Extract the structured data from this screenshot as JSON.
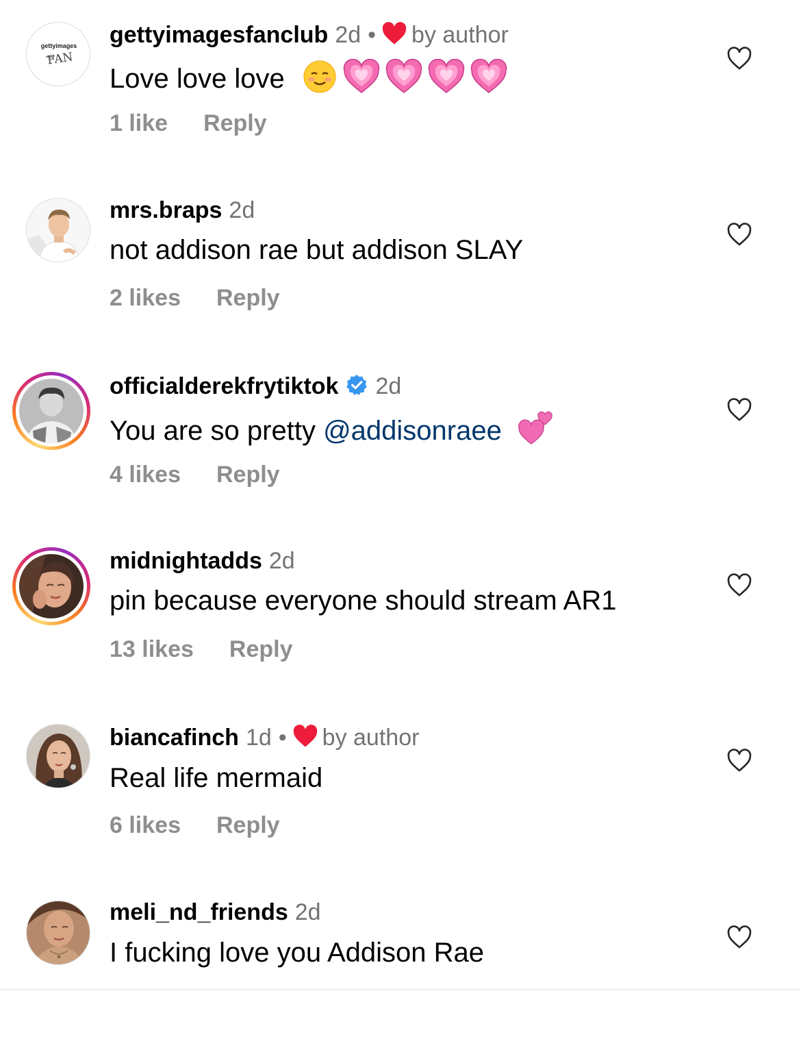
{
  "comments": [
    {
      "username": "gettyimagesfanclub",
      "time": "2d",
      "liked_by_author": true,
      "author_label": "by author",
      "text": "Love love love",
      "emojis": [
        "smiling-face-icon",
        "growing-heart-icon",
        "growing-heart-icon",
        "growing-heart-icon",
        "growing-heart-icon"
      ],
      "avatar_logo": "gettyimages FAN",
      "likes": "1 like",
      "reply": "Reply"
    },
    {
      "username": "mrs.braps",
      "time": "2d",
      "text": "not addison rae but addison SLAY",
      "likes": "2 likes",
      "reply": "Reply"
    },
    {
      "username": "officialderekfrytiktok",
      "verified": true,
      "time": "2d",
      "text": "You are so pretty ",
      "mention": "@addisonraee",
      "emojis": [
        "two-hearts-icon"
      ],
      "likes": "4 likes",
      "reply": "Reply"
    },
    {
      "username": "midnightadds",
      "time": "2d",
      "text": "pin because everyone should stream AR1",
      "likes": "13 likes",
      "reply": "Reply"
    },
    {
      "username": "biancafinch",
      "time": "1d",
      "liked_by_author": true,
      "author_label": "by author",
      "text": "Real life mermaid",
      "likes": "6 likes",
      "reply": "Reply"
    },
    {
      "username": "meli_nd_friends",
      "time": "2d",
      "text": "I fucking love you Addison Rae"
    }
  ],
  "colors": {
    "text": "#000000",
    "secondary": "#737373",
    "meta": "#8e8e8e",
    "mention": "#00376b",
    "author_heart": "#ed1c3a",
    "verified": "#3897f0",
    "pink_heart": "#f472b6"
  }
}
